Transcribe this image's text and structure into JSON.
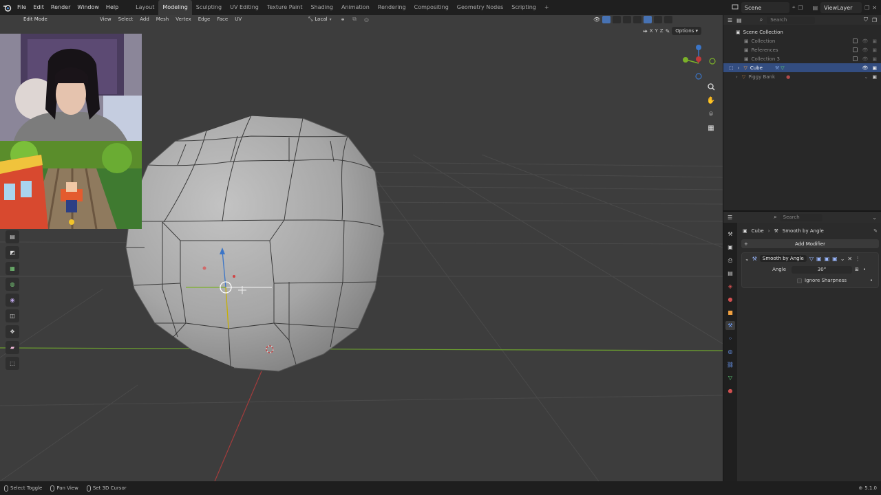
{
  "topbar": {
    "menus": [
      "File",
      "Edit",
      "Render",
      "Window",
      "Help"
    ],
    "workspaces": [
      "Layout",
      "Modeling",
      "Sculpting",
      "UV Editing",
      "Texture Paint",
      "Shading",
      "Animation",
      "Rendering",
      "Compositing",
      "Geometry Nodes",
      "Scripting"
    ],
    "active_workspace": "Modeling",
    "add_tab_label": "+",
    "scene_name": "Scene",
    "view_layer_name": "ViewLayer"
  },
  "viewport": {
    "mode_label": "Edit Mode",
    "menus": [
      "View",
      "Select",
      "Add",
      "Mesh",
      "Vertex",
      "Edge",
      "Face",
      "UV"
    ],
    "orientation": "Local",
    "options_label": "Options",
    "axes": [
      "X",
      "Y",
      "Z"
    ]
  },
  "outliner": {
    "search_placeholder": "Search",
    "root": "Scene Collection",
    "items": [
      {
        "name": "Collection"
      },
      {
        "name": "References"
      },
      {
        "name": "Collection 3"
      },
      {
        "name": "Cube"
      },
      {
        "name": "Piggy Bank"
      }
    ]
  },
  "properties": {
    "search_placeholder": "Search",
    "breadcrumb_object": "Cube",
    "breadcrumb_modifier": "Smooth by Angle",
    "add_modifier_label": "Add Modifier",
    "modifier": {
      "name": "Smooth by Angle",
      "angle_label": "Angle",
      "angle_value": "30°",
      "ignore_sharpness_label": "Ignore Sharpness"
    }
  },
  "statusbar": {
    "items": [
      "Select Toggle",
      "Pan View",
      "Set 3D Cursor"
    ],
    "version": "5.1.0"
  },
  "colors": {
    "accent": "#4772b3",
    "selection_row": "#334d80",
    "x_axis": "#c0393a",
    "y_axis": "#7bb129",
    "z_axis": "#3b75c7"
  }
}
